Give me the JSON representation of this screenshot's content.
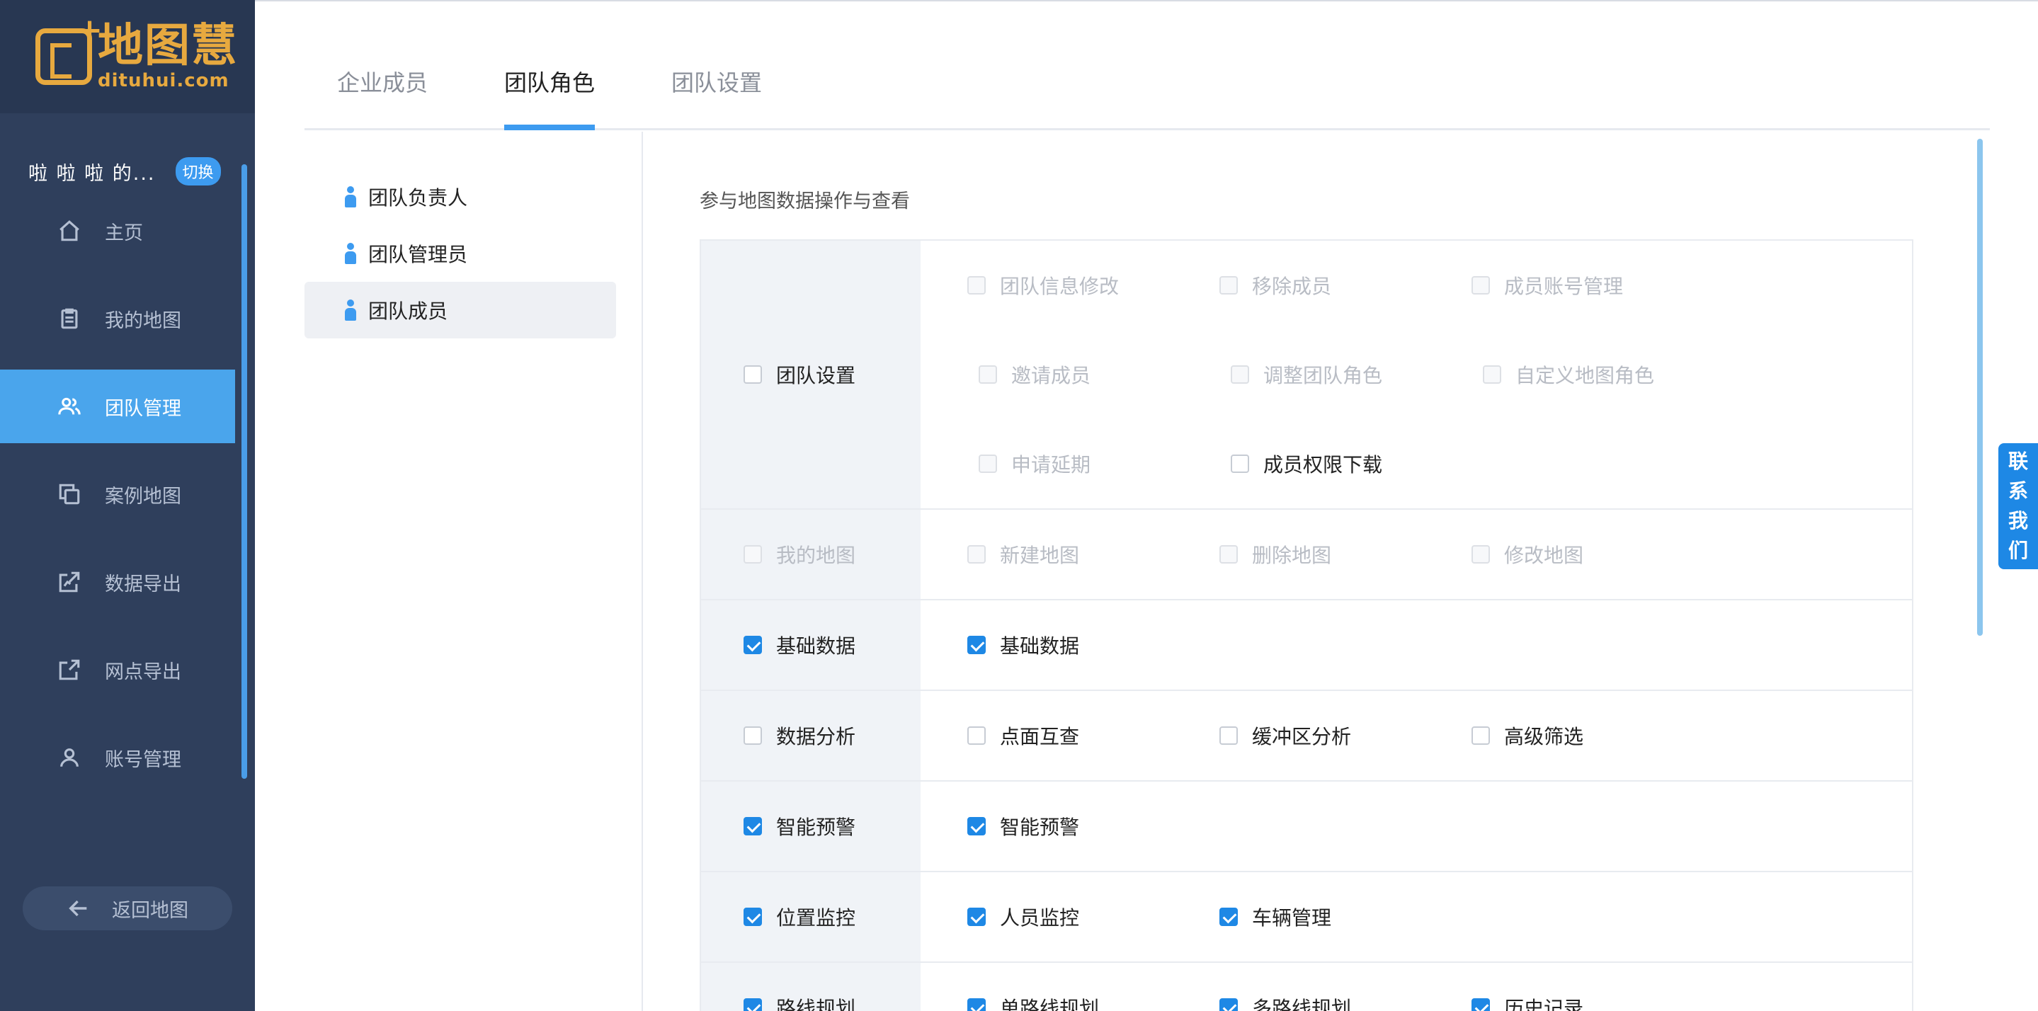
{
  "brand": {
    "cn": "地图慧",
    "en": "dituhui.com"
  },
  "team": {
    "name": "啦 啦 啦 的...",
    "switch_label": "切换"
  },
  "nav": [
    {
      "label": "主页",
      "icon": "home-icon",
      "active": false
    },
    {
      "label": "我的地图",
      "icon": "clipboard-icon",
      "active": false
    },
    {
      "label": "团队管理",
      "icon": "team-icon",
      "active": true
    },
    {
      "label": "案例地图",
      "icon": "copy-icon",
      "active": false
    },
    {
      "label": "数据导出",
      "icon": "export-icon",
      "active": false
    },
    {
      "label": "网点导出",
      "icon": "share-icon",
      "active": false
    },
    {
      "label": "账号管理",
      "icon": "user-icon",
      "active": false
    }
  ],
  "back_label": "返回地图",
  "tabs": [
    {
      "label": "企业成员",
      "active": false
    },
    {
      "label": "团队角色",
      "active": true
    },
    {
      "label": "团队设置",
      "active": false
    }
  ],
  "roles": [
    {
      "label": "团队负责人",
      "active": false
    },
    {
      "label": "团队管理员",
      "active": false
    },
    {
      "label": "团队成员",
      "active": true
    }
  ],
  "perm_title": "参与地图数据操作与查看",
  "permissions": [
    {
      "category": "团队设置",
      "checked": false,
      "disabled": false,
      "items": [
        {
          "label": "团队信息修改",
          "checked": false,
          "disabled": true
        },
        {
          "label": "移除成员",
          "checked": false,
          "disabled": true
        },
        {
          "label": "成员账号管理",
          "checked": false,
          "disabled": true
        },
        {
          "label": "邀请成员",
          "checked": false,
          "disabled": true
        },
        {
          "label": "调整团队角色",
          "checked": false,
          "disabled": true
        },
        {
          "label": "自定义地图角色",
          "checked": false,
          "disabled": true
        },
        {
          "label": "申请延期",
          "checked": false,
          "disabled": true
        },
        {
          "label": "成员权限下载",
          "checked": false,
          "disabled": false
        }
      ]
    },
    {
      "category": "我的地图",
      "checked": false,
      "disabled": true,
      "items": [
        {
          "label": "新建地图",
          "checked": false,
          "disabled": true
        },
        {
          "label": "删除地图",
          "checked": false,
          "disabled": true
        },
        {
          "label": "修改地图",
          "checked": false,
          "disabled": true
        }
      ]
    },
    {
      "category": "基础数据",
      "checked": true,
      "disabled": false,
      "items": [
        {
          "label": "基础数据",
          "checked": true,
          "disabled": false
        }
      ]
    },
    {
      "category": "数据分析",
      "checked": false,
      "disabled": false,
      "items": [
        {
          "label": "点面互查",
          "checked": false,
          "disabled": false
        },
        {
          "label": "缓冲区分析",
          "checked": false,
          "disabled": false
        },
        {
          "label": "高级筛选",
          "checked": false,
          "disabled": false
        }
      ]
    },
    {
      "category": "智能预警",
      "checked": true,
      "disabled": false,
      "items": [
        {
          "label": "智能预警",
          "checked": true,
          "disabled": false
        }
      ]
    },
    {
      "category": "位置监控",
      "checked": true,
      "disabled": false,
      "items": [
        {
          "label": "人员监控",
          "checked": true,
          "disabled": false
        },
        {
          "label": "车辆管理",
          "checked": true,
          "disabled": false
        }
      ]
    },
    {
      "category": "路线规划",
      "checked": true,
      "disabled": false,
      "items": [
        {
          "label": "单路线规划",
          "checked": true,
          "disabled": false
        },
        {
          "label": "多路线规划",
          "checked": true,
          "disabled": false
        },
        {
          "label": "历史记录",
          "checked": true,
          "disabled": false
        }
      ]
    }
  ],
  "contact_chars": [
    "联",
    "系",
    "我",
    "们"
  ]
}
